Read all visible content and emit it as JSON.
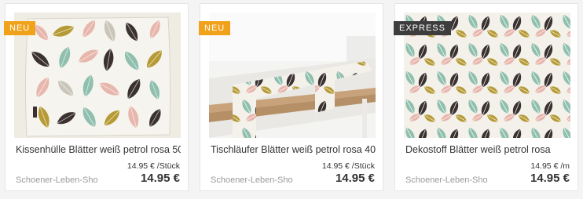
{
  "products": [
    {
      "badge": "NEU",
      "title": "Kissenhülle Blätter weiß petrol rosa 50",
      "unit_price": "14.95 € /Stück",
      "shop": "Schoener-Leben-Sho",
      "price": "14.95 €"
    },
    {
      "badge": "NEU",
      "title": "Tischläufer Blätter weiß petrol rosa 40",
      "unit_price": "14.95 € /Stück",
      "shop": "Schoener-Leben-Sho",
      "price": "14.95 €"
    },
    {
      "badge": "EXPRESS",
      "title": "Dekostoff Blätter weiß petrol rosa",
      "unit_price": "14.95 € /m",
      "shop": "Schoener-Leben-Sho",
      "price": "14.95 €"
    }
  ],
  "colors": {
    "badge_neu": "#f0a21a",
    "badge_express": "#3d3d3d",
    "leaf_mint": "#8fbfae",
    "leaf_pink": "#e7b6ad",
    "leaf_olive": "#b59a35",
    "leaf_dark": "#3a3130",
    "leaf_grey": "#c9c6b9"
  }
}
